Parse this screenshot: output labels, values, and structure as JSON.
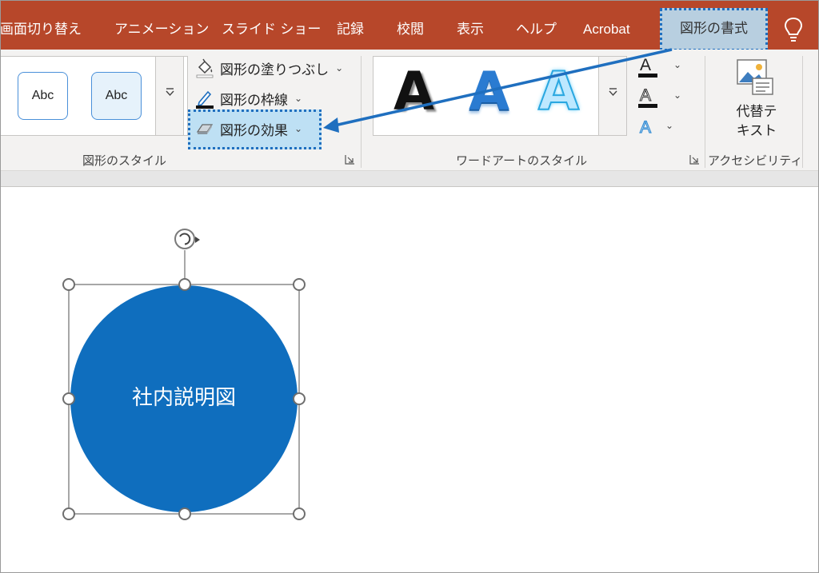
{
  "tabs": [
    {
      "label": "画面切り替え",
      "active": false
    },
    {
      "label": "アニメーション",
      "active": false
    },
    {
      "label": "スライド ショー",
      "active": false
    },
    {
      "label": "記録",
      "active": false
    },
    {
      "label": "校閲",
      "active": false
    },
    {
      "label": "表示",
      "active": false
    },
    {
      "label": "ヘルプ",
      "active": false
    },
    {
      "label": "Acrobat",
      "active": false
    },
    {
      "label": "図形の書式",
      "active": true
    }
  ],
  "tell_me_icon": "lightbulb-icon",
  "ribbon": {
    "shape_styles": {
      "gallery": [
        "Abc",
        "Abc"
      ],
      "fill_label": "図形の塗りつぶし",
      "outline_label": "図形の枠線",
      "effects_label": "図形の効果",
      "group_label": "図形のスタイル"
    },
    "wordart_styles": {
      "samples": [
        "A",
        "A",
        "A"
      ],
      "group_label": "ワードアートのスタイル"
    },
    "accessibility": {
      "alt_text_label_line1": "代替テ",
      "alt_text_label_line2": "キスト",
      "group_label": "アクセシビリティ"
    }
  },
  "slide": {
    "shape_text": "社内説明図",
    "shape_color": "#0f6ebe"
  },
  "colors": {
    "tab_bar": "#b7472a",
    "highlight": "#b8def4",
    "highlight_border": "#1f6fbf",
    "callout_arrow": "#1f6fbf"
  }
}
